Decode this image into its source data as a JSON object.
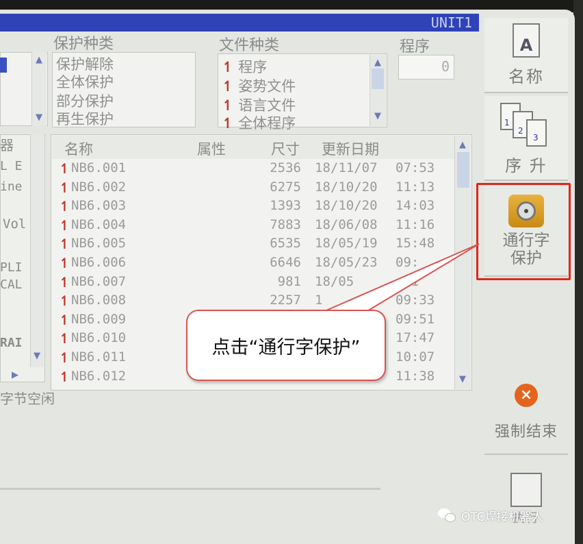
{
  "titlebar": {
    "unit": "UNIT1"
  },
  "left_strip": {
    "items": [
      "器",
      "L E I",
      "ine",
      "Vol",
      "PLI",
      "CAL",
      "RAI"
    ],
    "footer": "字节空闲"
  },
  "protect_type": {
    "label": "保护种类",
    "options": [
      "保护解除",
      "全体保护",
      "部分保护",
      "再生保护"
    ]
  },
  "file_type": {
    "label": "文件种类",
    "options": [
      "程序",
      "姿势文件",
      "语言文件",
      "全体程序"
    ]
  },
  "program": {
    "label": "程序",
    "value": "0"
  },
  "file_list": {
    "headers": {
      "name": "名称",
      "attr": "属性",
      "size": "尺寸",
      "date": "更新日期"
    },
    "rows": [
      {
        "name": "NB6.001",
        "size": "2536",
        "date": "18/11/07",
        "time": "07:53"
      },
      {
        "name": "NB6.002",
        "size": "6275",
        "date": "18/10/20",
        "time": "11:13"
      },
      {
        "name": "NB6.003",
        "size": "1393",
        "date": "18/10/20",
        "time": "14:03"
      },
      {
        "name": "NB6.004",
        "size": "7883",
        "date": "18/06/08",
        "time": "11:16"
      },
      {
        "name": "NB6.005",
        "size": "6535",
        "date": "18/05/19",
        "time": "15:48"
      },
      {
        "name": "NB6.006",
        "size": "6646",
        "date": "18/05/23",
        "time": "09:"
      },
      {
        "name": "NB6.007",
        "size": "981",
        "date": "18/05",
        "time": ":01"
      },
      {
        "name": "NB6.008",
        "size": "2257",
        "date": "1",
        "time": "09:33"
      },
      {
        "name": "NB6.009",
        "size": "",
        "date": "",
        "time": "09:51"
      },
      {
        "name": "NB6.010",
        "size": "",
        "date": "",
        "time": "17:47"
      },
      {
        "name": "NB6.011",
        "size": "",
        "date": "",
        "time": "10:07"
      },
      {
        "name": "NB6.012",
        "size": "",
        "date": "",
        "time": "11:38"
      }
    ]
  },
  "right_panel": {
    "name_btn": "名称",
    "sort_btn": "序 升",
    "protect_btn_line1": "通行字",
    "protect_btn_line2": "保护",
    "force_end_btn": "强制结束",
    "exec_btn": "执行"
  },
  "callout": {
    "text": "点击“通行字保护”"
  },
  "watermark": {
    "text": "OTC焊接机器人"
  },
  "colors": {
    "title_bar": "#2f42b8",
    "highlight": "#e0261c",
    "file_icon": "#c0392b"
  }
}
